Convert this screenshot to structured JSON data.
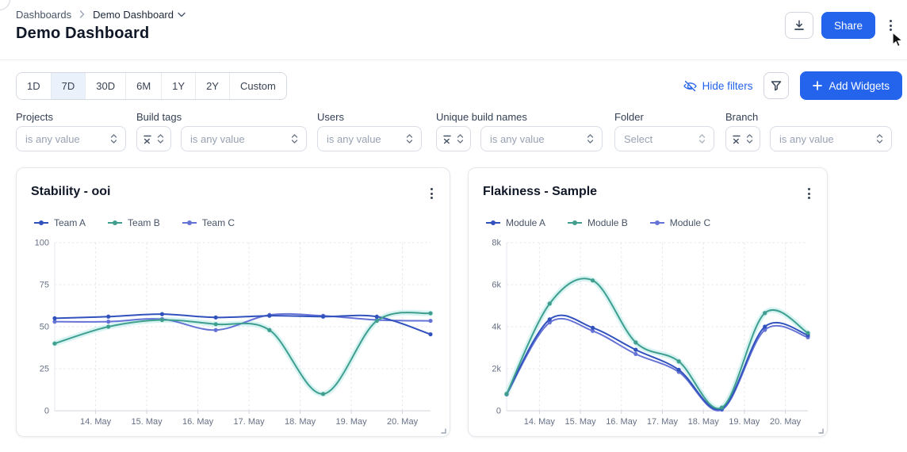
{
  "header": {
    "breadcrumb_root": "Dashboards",
    "breadcrumb_current": "Demo Dashboard",
    "title": "Demo Dashboard",
    "share_label": "Share"
  },
  "toolbar": {
    "ranges": [
      "1D",
      "7D",
      "30D",
      "6M",
      "1Y",
      "2Y",
      "Custom"
    ],
    "selected_range": "7D",
    "hide_filters_label": "Hide filters",
    "add_widgets_label": "Add Widgets"
  },
  "filters": {
    "groups": [
      {
        "label": "Projects",
        "select_placeholder": "is any value"
      },
      {
        "label": "Build tags",
        "select_placeholder": "is any value"
      },
      {
        "label": "Users",
        "select_placeholder": "is any value"
      },
      {
        "label": "Unique build names",
        "select_placeholder": "is any value"
      },
      {
        "label": "Folder",
        "select_placeholder": "Select"
      },
      {
        "label": "Branch",
        "select_placeholder": "is any value"
      }
    ]
  },
  "colors": {
    "accent_blue": "#2463eb",
    "series_a": "#3152bd",
    "series_b": "#3f9e8e",
    "series_c": "#6673d6",
    "series_b_glow": "#c9f0ef",
    "grid": "#e4e7ec",
    "axis": "#d0d5dd",
    "tick_text": "#667085"
  },
  "chart_data": [
    {
      "type": "line",
      "title": "Stability - ooi",
      "x_labels": [
        "14. May",
        "15. May",
        "16. May",
        "17. May",
        "18. May",
        "19. May",
        "20. May"
      ],
      "y_ticks": [
        0,
        25,
        50,
        75,
        100
      ],
      "y_tick_labels": [
        "0",
        "25",
        "50",
        "75",
        "100"
      ],
      "ylim": [
        0,
        100
      ],
      "grid": true,
      "legend_position": "top-left",
      "series": [
        {
          "name": "Team A",
          "color": "#3152bd",
          "values": [
            55,
            56,
            57.5,
            55.5,
            56.5,
            56,
            56,
            45.5
          ]
        },
        {
          "name": "Team B",
          "color": "#3f9e8e",
          "glow": "#c9f0ef",
          "values": [
            40,
            50,
            54,
            51.5,
            48,
            10,
            53.5,
            58
          ]
        },
        {
          "name": "Team C",
          "color": "#6673d6",
          "values": [
            53,
            53,
            54.5,
            48,
            57,
            56.5,
            54,
            53.5
          ]
        }
      ]
    },
    {
      "type": "line",
      "title": "Flakiness - Sample",
      "x_labels": [
        "14. May",
        "15. May",
        "16. May",
        "17. May",
        "18. May",
        "19. May",
        "20. May"
      ],
      "y_ticks": [
        0,
        2000,
        4000,
        6000,
        8000
      ],
      "y_tick_labels": [
        "0",
        "2k",
        "4k",
        "6k",
        "8k"
      ],
      "ylim": [
        0,
        8000
      ],
      "grid": true,
      "legend_position": "top-left",
      "series": [
        {
          "name": "Module A",
          "color": "#3152bd",
          "values": [
            800,
            4350,
            3950,
            2900,
            1950,
            100,
            4000,
            3600
          ]
        },
        {
          "name": "Module B",
          "color": "#3f9e8e",
          "glow": "#c9f0ef",
          "values": [
            800,
            5100,
            6200,
            3250,
            2350,
            150,
            4650,
            3700
          ]
        },
        {
          "name": "Module C",
          "color": "#6673d6",
          "values": [
            780,
            4200,
            3800,
            2700,
            1850,
            50,
            3850,
            3500
          ]
        }
      ]
    }
  ]
}
